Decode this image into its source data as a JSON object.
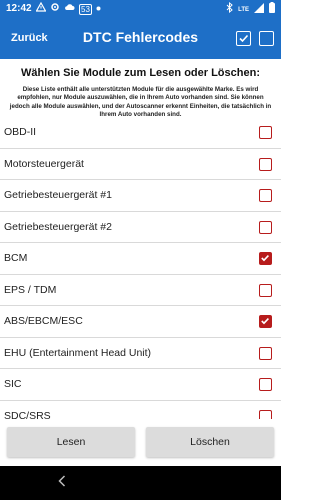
{
  "status_bar": {
    "time": "12:42",
    "notification_icons": [
      "warning-icon",
      "settings-icon",
      "cloud-icon",
      "app-badge-icon",
      "dot-icon"
    ],
    "app_badge_text": "53",
    "right_icons": [
      "bluetooth-icon",
      "lte-signal-icon",
      "signal-icon",
      "battery-icon"
    ],
    "lte_text": "LTE"
  },
  "app_bar": {
    "back_label": "Zurück",
    "title": "DTC Fehlercodes",
    "select_all_icon": "checked-box-icon",
    "deselect_all_icon": "empty-box-icon"
  },
  "instructions": {
    "heading": "Wählen Sie Module zum Lesen oder Löschen:",
    "description": "Diese Liste enthält alle unterstützten Module für die ausgewählte Marke. Es wird empfohlen, nur Module auszuwählen, die in Ihrem Auto vorhanden sind. Sie können jedoch alle Module auswählen, und der Autoscanner erkennt Einheiten, die tatsächlich in Ihrem Auto vorhanden sind."
  },
  "modules": [
    {
      "label": "OBD-II",
      "checked": false
    },
    {
      "label": "Motorsteuergerät",
      "checked": false
    },
    {
      "label": "Getriebesteuergerät #1",
      "checked": false
    },
    {
      "label": "Getriebesteuergerät #2",
      "checked": false
    },
    {
      "label": "BCM",
      "checked": true
    },
    {
      "label": "EPS / TDM",
      "checked": false
    },
    {
      "label": "ABS/EBCM/ESC",
      "checked": true
    },
    {
      "label": "EHU (Entertainment Head Unit)",
      "checked": false
    },
    {
      "label": "SIC",
      "checked": false
    },
    {
      "label": "SDC/SRS",
      "checked": false
    }
  ],
  "buttons": {
    "read_label": "Lesen",
    "delete_label": "Löschen"
  },
  "colors": {
    "primary": "#1e6fc7",
    "checkbox": "#b71c1c"
  }
}
